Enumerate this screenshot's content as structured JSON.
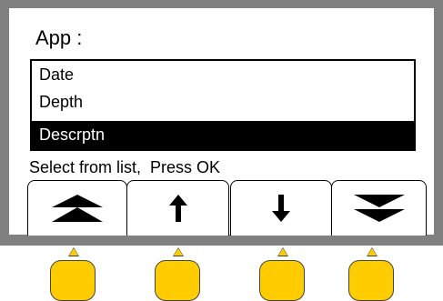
{
  "screen": {
    "title": "App :",
    "list": {
      "items": [
        {
          "label": "Date",
          "selected": false
        },
        {
          "label": "Depth",
          "selected": false
        },
        {
          "label": "Descrptn",
          "selected": true
        }
      ]
    },
    "status": "Select from list,  Press OK"
  },
  "softkeys": [
    {
      "icon": "double-chevron-up-icon",
      "action": "page-up"
    },
    {
      "icon": "arrow-up-icon",
      "action": "up"
    },
    {
      "icon": "arrow-down-icon",
      "action": "down"
    },
    {
      "icon": "double-chevron-down-icon",
      "action": "page-down"
    }
  ],
  "colors": {
    "bezel": "#808080",
    "button": "#ffcc00",
    "selection": "#000000"
  }
}
